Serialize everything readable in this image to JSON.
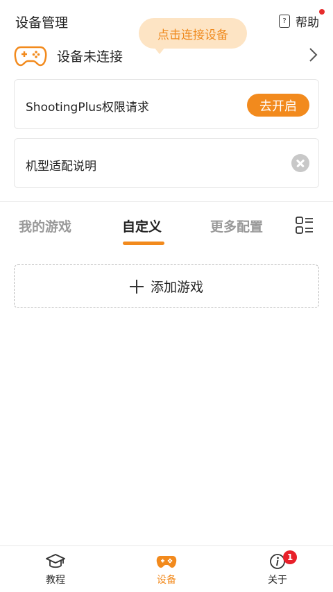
{
  "header": {
    "title": "设备管理",
    "help_label": "帮助",
    "help_icon": "question-doc-icon"
  },
  "tooltip": {
    "text": "点击连接设备"
  },
  "device": {
    "status": "设备未连接",
    "icon": "gamepad-icon"
  },
  "permission_card": {
    "text": "ShootingPlus权限请求",
    "button_label": "去开启"
  },
  "compat_card": {
    "text": "机型适配说明"
  },
  "tabs": [
    {
      "label": "我的游戏",
      "active": false
    },
    {
      "label": "自定义",
      "active": true
    },
    {
      "label": "更多配置",
      "active": false
    }
  ],
  "add_game": {
    "label": "添加游戏"
  },
  "bottom_nav": [
    {
      "label": "教程",
      "icon": "graduation-cap-icon",
      "active": false
    },
    {
      "label": "设备",
      "icon": "gamepad-icon",
      "active": true
    },
    {
      "label": "关于",
      "icon": "info-icon",
      "active": false,
      "badge": "1"
    }
  ],
  "colors": {
    "accent": "#f28a1d",
    "tooltip_bg": "#fde4c4",
    "badge": "#e8202a"
  }
}
